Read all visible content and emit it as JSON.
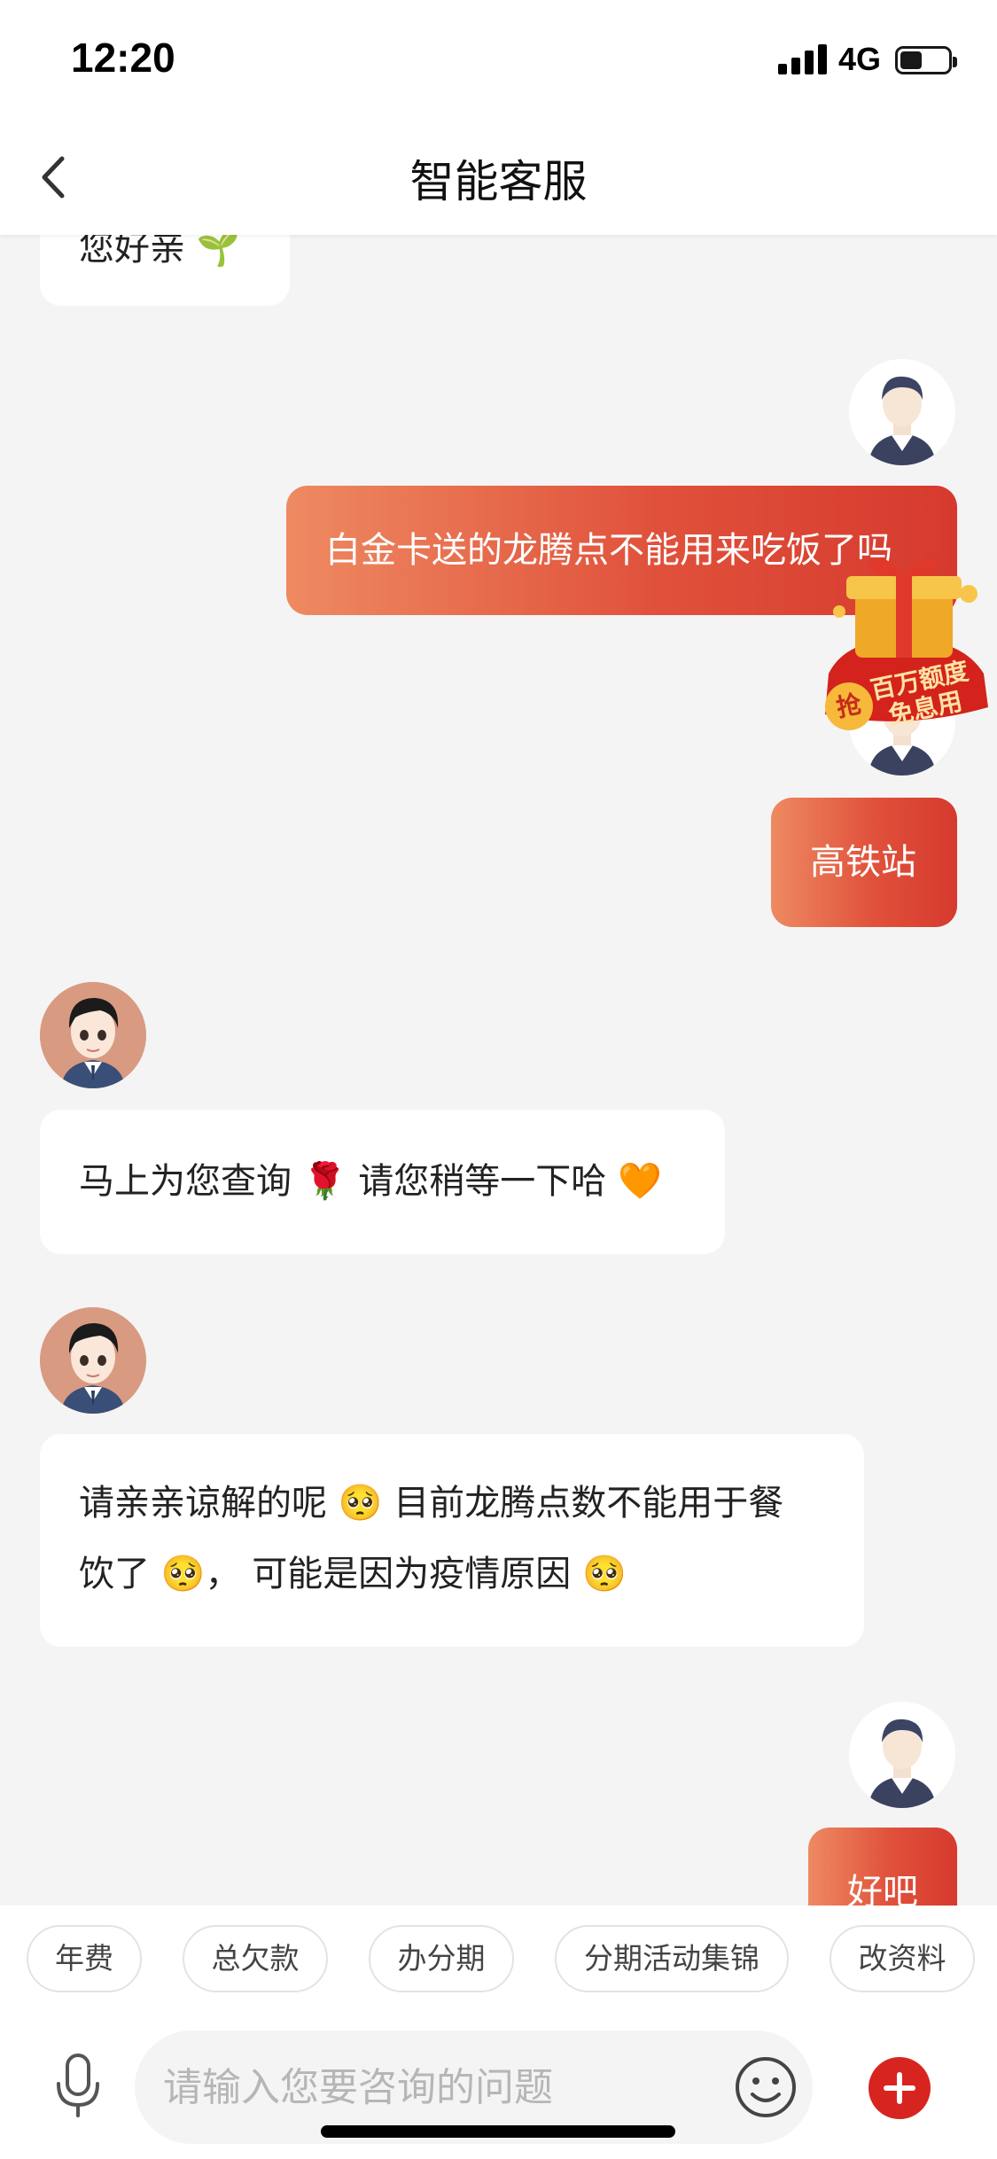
{
  "status_bar": {
    "time": "12:20",
    "network": "4G"
  },
  "header": {
    "title": "智能客服"
  },
  "messages": [
    {
      "role": "agent",
      "text": "您好亲 🌱"
    },
    {
      "role": "user",
      "text": "白金卡送的龙腾点不能用来吃饭了吗"
    },
    {
      "role": "user",
      "text": "高铁站"
    },
    {
      "role": "agent",
      "text": "马上为您查询 🌹 请您稍等一下哈 🧡"
    },
    {
      "role": "agent",
      "line1": "请亲亲谅解的呢 🥺 目前龙腾点数不能用于餐",
      "line2": "饮了 🥺， 可能是因为疫情原因 🥺"
    },
    {
      "role": "user",
      "text": "好吧"
    }
  ],
  "promo": {
    "grab": "抢",
    "line1": "百万额度",
    "line2": "免息用"
  },
  "quick_replies": [
    "年费",
    "总欠款",
    "办分期",
    "分期活动集锦",
    "改资料"
  ],
  "input": {
    "placeholder": "请输入您要咨询的问题"
  },
  "icons": {
    "back": "chevron-left-icon",
    "mic": "microphone-icon",
    "emoji": "smiley-icon",
    "plus": "plus-icon"
  },
  "colors": {
    "user_bubble_start": "#ee8a62",
    "user_bubble_end": "#d63a2e",
    "plus_button": "#d8241f",
    "background": "#f4f4f4"
  }
}
